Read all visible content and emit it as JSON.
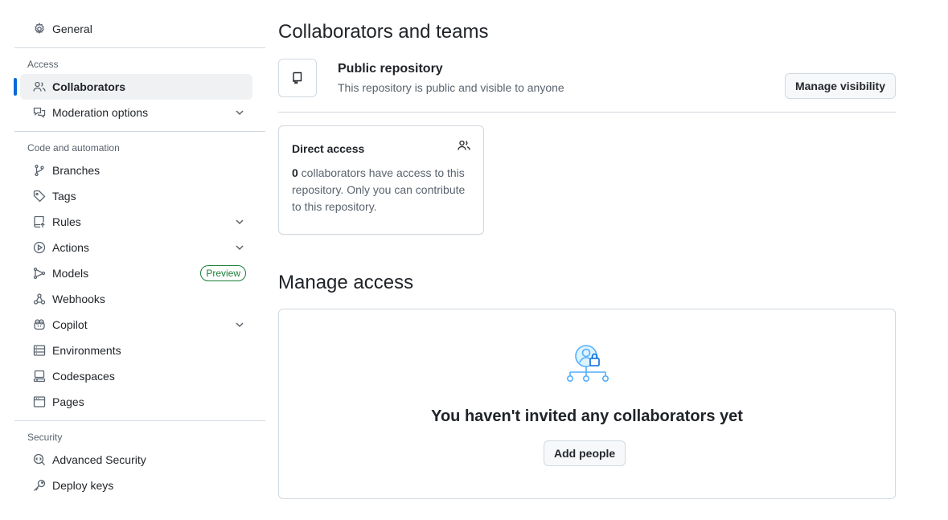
{
  "sidebar": {
    "general": "General",
    "access_heading": "Access",
    "collaborators": "Collaborators",
    "moderation": "Moderation options",
    "code_heading": "Code and automation",
    "branches": "Branches",
    "tags": "Tags",
    "rules": "Rules",
    "actions": "Actions",
    "models": "Models",
    "models_badge": "Preview",
    "webhooks": "Webhooks",
    "copilot": "Copilot",
    "environments": "Environments",
    "codespaces": "Codespaces",
    "pages": "Pages",
    "security_heading": "Security",
    "advanced_security": "Advanced Security",
    "deploy_keys": "Deploy keys"
  },
  "main": {
    "title": "Collaborators and teams",
    "repo_title": "Public repository",
    "repo_sub": "This repository is public and visible to anyone",
    "manage_visibility": "Manage visibility",
    "direct_title": "Direct access",
    "direct_count": "0",
    "direct_body": " collaborators have access to this repository. Only you can contribute to this repository.",
    "manage_title": "Manage access",
    "empty_title": "You haven't invited any collaborators yet",
    "add_people": "Add people"
  },
  "colors": {
    "accent": "#0969da",
    "badge": "#1a7f37",
    "illustration": "#54aeff"
  }
}
